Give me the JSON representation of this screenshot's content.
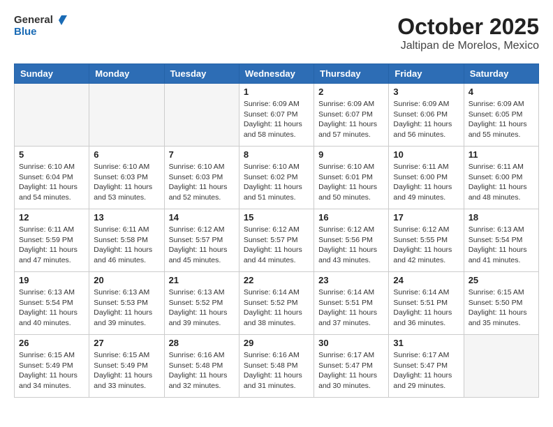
{
  "header": {
    "logo_general": "General",
    "logo_blue": "Blue",
    "month": "October 2025",
    "location": "Jaltipan de Morelos, Mexico"
  },
  "weekdays": [
    "Sunday",
    "Monday",
    "Tuesday",
    "Wednesday",
    "Thursday",
    "Friday",
    "Saturday"
  ],
  "weeks": [
    [
      {
        "day": "",
        "info": ""
      },
      {
        "day": "",
        "info": ""
      },
      {
        "day": "",
        "info": ""
      },
      {
        "day": "1",
        "info": "Sunrise: 6:09 AM\nSunset: 6:07 PM\nDaylight: 11 hours\nand 58 minutes."
      },
      {
        "day": "2",
        "info": "Sunrise: 6:09 AM\nSunset: 6:07 PM\nDaylight: 11 hours\nand 57 minutes."
      },
      {
        "day": "3",
        "info": "Sunrise: 6:09 AM\nSunset: 6:06 PM\nDaylight: 11 hours\nand 56 minutes."
      },
      {
        "day": "4",
        "info": "Sunrise: 6:09 AM\nSunset: 6:05 PM\nDaylight: 11 hours\nand 55 minutes."
      }
    ],
    [
      {
        "day": "5",
        "info": "Sunrise: 6:10 AM\nSunset: 6:04 PM\nDaylight: 11 hours\nand 54 minutes."
      },
      {
        "day": "6",
        "info": "Sunrise: 6:10 AM\nSunset: 6:03 PM\nDaylight: 11 hours\nand 53 minutes."
      },
      {
        "day": "7",
        "info": "Sunrise: 6:10 AM\nSunset: 6:03 PM\nDaylight: 11 hours\nand 52 minutes."
      },
      {
        "day": "8",
        "info": "Sunrise: 6:10 AM\nSunset: 6:02 PM\nDaylight: 11 hours\nand 51 minutes."
      },
      {
        "day": "9",
        "info": "Sunrise: 6:10 AM\nSunset: 6:01 PM\nDaylight: 11 hours\nand 50 minutes."
      },
      {
        "day": "10",
        "info": "Sunrise: 6:11 AM\nSunset: 6:00 PM\nDaylight: 11 hours\nand 49 minutes."
      },
      {
        "day": "11",
        "info": "Sunrise: 6:11 AM\nSunset: 6:00 PM\nDaylight: 11 hours\nand 48 minutes."
      }
    ],
    [
      {
        "day": "12",
        "info": "Sunrise: 6:11 AM\nSunset: 5:59 PM\nDaylight: 11 hours\nand 47 minutes."
      },
      {
        "day": "13",
        "info": "Sunrise: 6:11 AM\nSunset: 5:58 PM\nDaylight: 11 hours\nand 46 minutes."
      },
      {
        "day": "14",
        "info": "Sunrise: 6:12 AM\nSunset: 5:57 PM\nDaylight: 11 hours\nand 45 minutes."
      },
      {
        "day": "15",
        "info": "Sunrise: 6:12 AM\nSunset: 5:57 PM\nDaylight: 11 hours\nand 44 minutes."
      },
      {
        "day": "16",
        "info": "Sunrise: 6:12 AM\nSunset: 5:56 PM\nDaylight: 11 hours\nand 43 minutes."
      },
      {
        "day": "17",
        "info": "Sunrise: 6:12 AM\nSunset: 5:55 PM\nDaylight: 11 hours\nand 42 minutes."
      },
      {
        "day": "18",
        "info": "Sunrise: 6:13 AM\nSunset: 5:54 PM\nDaylight: 11 hours\nand 41 minutes."
      }
    ],
    [
      {
        "day": "19",
        "info": "Sunrise: 6:13 AM\nSunset: 5:54 PM\nDaylight: 11 hours\nand 40 minutes."
      },
      {
        "day": "20",
        "info": "Sunrise: 6:13 AM\nSunset: 5:53 PM\nDaylight: 11 hours\nand 39 minutes."
      },
      {
        "day": "21",
        "info": "Sunrise: 6:13 AM\nSunset: 5:52 PM\nDaylight: 11 hours\nand 39 minutes."
      },
      {
        "day": "22",
        "info": "Sunrise: 6:14 AM\nSunset: 5:52 PM\nDaylight: 11 hours\nand 38 minutes."
      },
      {
        "day": "23",
        "info": "Sunrise: 6:14 AM\nSunset: 5:51 PM\nDaylight: 11 hours\nand 37 minutes."
      },
      {
        "day": "24",
        "info": "Sunrise: 6:14 AM\nSunset: 5:51 PM\nDaylight: 11 hours\nand 36 minutes."
      },
      {
        "day": "25",
        "info": "Sunrise: 6:15 AM\nSunset: 5:50 PM\nDaylight: 11 hours\nand 35 minutes."
      }
    ],
    [
      {
        "day": "26",
        "info": "Sunrise: 6:15 AM\nSunset: 5:49 PM\nDaylight: 11 hours\nand 34 minutes."
      },
      {
        "day": "27",
        "info": "Sunrise: 6:15 AM\nSunset: 5:49 PM\nDaylight: 11 hours\nand 33 minutes."
      },
      {
        "day": "28",
        "info": "Sunrise: 6:16 AM\nSunset: 5:48 PM\nDaylight: 11 hours\nand 32 minutes."
      },
      {
        "day": "29",
        "info": "Sunrise: 6:16 AM\nSunset: 5:48 PM\nDaylight: 11 hours\nand 31 minutes."
      },
      {
        "day": "30",
        "info": "Sunrise: 6:17 AM\nSunset: 5:47 PM\nDaylight: 11 hours\nand 30 minutes."
      },
      {
        "day": "31",
        "info": "Sunrise: 6:17 AM\nSunset: 5:47 PM\nDaylight: 11 hours\nand 29 minutes."
      },
      {
        "day": "",
        "info": ""
      }
    ]
  ]
}
